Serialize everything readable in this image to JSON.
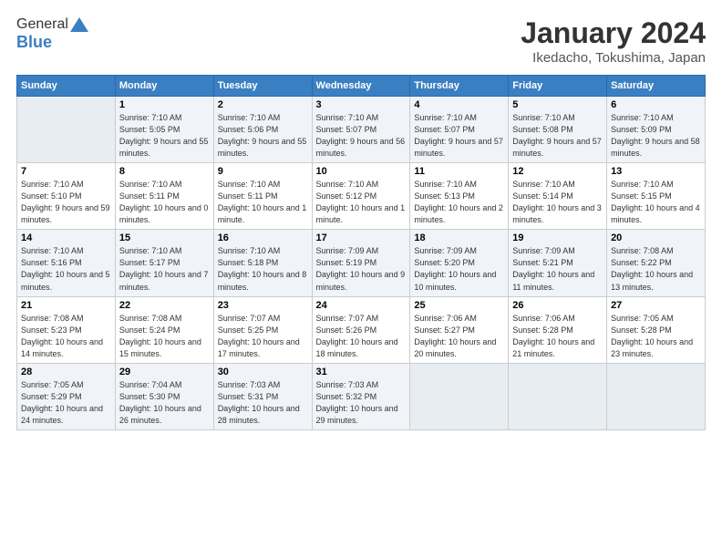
{
  "logo": {
    "line1": "General",
    "line2": "Blue"
  },
  "header": {
    "month": "January 2024",
    "location": "Ikedacho, Tokushima, Japan"
  },
  "weekdays": [
    "Sunday",
    "Monday",
    "Tuesday",
    "Wednesday",
    "Thursday",
    "Friday",
    "Saturday"
  ],
  "weeks": [
    [
      {
        "day": "",
        "empty": true
      },
      {
        "day": "1",
        "sunrise": "Sunrise: 7:10 AM",
        "sunset": "Sunset: 5:05 PM",
        "daylight": "Daylight: 9 hours and 55 minutes."
      },
      {
        "day": "2",
        "sunrise": "Sunrise: 7:10 AM",
        "sunset": "Sunset: 5:06 PM",
        "daylight": "Daylight: 9 hours and 55 minutes."
      },
      {
        "day": "3",
        "sunrise": "Sunrise: 7:10 AM",
        "sunset": "Sunset: 5:07 PM",
        "daylight": "Daylight: 9 hours and 56 minutes."
      },
      {
        "day": "4",
        "sunrise": "Sunrise: 7:10 AM",
        "sunset": "Sunset: 5:07 PM",
        "daylight": "Daylight: 9 hours and 57 minutes."
      },
      {
        "day": "5",
        "sunrise": "Sunrise: 7:10 AM",
        "sunset": "Sunset: 5:08 PM",
        "daylight": "Daylight: 9 hours and 57 minutes."
      },
      {
        "day": "6",
        "sunrise": "Sunrise: 7:10 AM",
        "sunset": "Sunset: 5:09 PM",
        "daylight": "Daylight: 9 hours and 58 minutes."
      }
    ],
    [
      {
        "day": "7",
        "sunrise": "Sunrise: 7:10 AM",
        "sunset": "Sunset: 5:10 PM",
        "daylight": "Daylight: 9 hours and 59 minutes."
      },
      {
        "day": "8",
        "sunrise": "Sunrise: 7:10 AM",
        "sunset": "Sunset: 5:11 PM",
        "daylight": "Daylight: 10 hours and 0 minutes."
      },
      {
        "day": "9",
        "sunrise": "Sunrise: 7:10 AM",
        "sunset": "Sunset: 5:11 PM",
        "daylight": "Daylight: 10 hours and 1 minute."
      },
      {
        "day": "10",
        "sunrise": "Sunrise: 7:10 AM",
        "sunset": "Sunset: 5:12 PM",
        "daylight": "Daylight: 10 hours and 1 minute."
      },
      {
        "day": "11",
        "sunrise": "Sunrise: 7:10 AM",
        "sunset": "Sunset: 5:13 PM",
        "daylight": "Daylight: 10 hours and 2 minutes."
      },
      {
        "day": "12",
        "sunrise": "Sunrise: 7:10 AM",
        "sunset": "Sunset: 5:14 PM",
        "daylight": "Daylight: 10 hours and 3 minutes."
      },
      {
        "day": "13",
        "sunrise": "Sunrise: 7:10 AM",
        "sunset": "Sunset: 5:15 PM",
        "daylight": "Daylight: 10 hours and 4 minutes."
      }
    ],
    [
      {
        "day": "14",
        "sunrise": "Sunrise: 7:10 AM",
        "sunset": "Sunset: 5:16 PM",
        "daylight": "Daylight: 10 hours and 5 minutes."
      },
      {
        "day": "15",
        "sunrise": "Sunrise: 7:10 AM",
        "sunset": "Sunset: 5:17 PM",
        "daylight": "Daylight: 10 hours and 7 minutes."
      },
      {
        "day": "16",
        "sunrise": "Sunrise: 7:10 AM",
        "sunset": "Sunset: 5:18 PM",
        "daylight": "Daylight: 10 hours and 8 minutes."
      },
      {
        "day": "17",
        "sunrise": "Sunrise: 7:09 AM",
        "sunset": "Sunset: 5:19 PM",
        "daylight": "Daylight: 10 hours and 9 minutes."
      },
      {
        "day": "18",
        "sunrise": "Sunrise: 7:09 AM",
        "sunset": "Sunset: 5:20 PM",
        "daylight": "Daylight: 10 hours and 10 minutes."
      },
      {
        "day": "19",
        "sunrise": "Sunrise: 7:09 AM",
        "sunset": "Sunset: 5:21 PM",
        "daylight": "Daylight: 10 hours and 11 minutes."
      },
      {
        "day": "20",
        "sunrise": "Sunrise: 7:08 AM",
        "sunset": "Sunset: 5:22 PM",
        "daylight": "Daylight: 10 hours and 13 minutes."
      }
    ],
    [
      {
        "day": "21",
        "sunrise": "Sunrise: 7:08 AM",
        "sunset": "Sunset: 5:23 PM",
        "daylight": "Daylight: 10 hours and 14 minutes."
      },
      {
        "day": "22",
        "sunrise": "Sunrise: 7:08 AM",
        "sunset": "Sunset: 5:24 PM",
        "daylight": "Daylight: 10 hours and 15 minutes."
      },
      {
        "day": "23",
        "sunrise": "Sunrise: 7:07 AM",
        "sunset": "Sunset: 5:25 PM",
        "daylight": "Daylight: 10 hours and 17 minutes."
      },
      {
        "day": "24",
        "sunrise": "Sunrise: 7:07 AM",
        "sunset": "Sunset: 5:26 PM",
        "daylight": "Daylight: 10 hours and 18 minutes."
      },
      {
        "day": "25",
        "sunrise": "Sunrise: 7:06 AM",
        "sunset": "Sunset: 5:27 PM",
        "daylight": "Daylight: 10 hours and 20 minutes."
      },
      {
        "day": "26",
        "sunrise": "Sunrise: 7:06 AM",
        "sunset": "Sunset: 5:28 PM",
        "daylight": "Daylight: 10 hours and 21 minutes."
      },
      {
        "day": "27",
        "sunrise": "Sunrise: 7:05 AM",
        "sunset": "Sunset: 5:28 PM",
        "daylight": "Daylight: 10 hours and 23 minutes."
      }
    ],
    [
      {
        "day": "28",
        "sunrise": "Sunrise: 7:05 AM",
        "sunset": "Sunset: 5:29 PM",
        "daylight": "Daylight: 10 hours and 24 minutes."
      },
      {
        "day": "29",
        "sunrise": "Sunrise: 7:04 AM",
        "sunset": "Sunset: 5:30 PM",
        "daylight": "Daylight: 10 hours and 26 minutes."
      },
      {
        "day": "30",
        "sunrise": "Sunrise: 7:03 AM",
        "sunset": "Sunset: 5:31 PM",
        "daylight": "Daylight: 10 hours and 28 minutes."
      },
      {
        "day": "31",
        "sunrise": "Sunrise: 7:03 AM",
        "sunset": "Sunset: 5:32 PM",
        "daylight": "Daylight: 10 hours and 29 minutes."
      },
      {
        "day": "",
        "empty": true
      },
      {
        "day": "",
        "empty": true
      },
      {
        "day": "",
        "empty": true
      }
    ]
  ]
}
